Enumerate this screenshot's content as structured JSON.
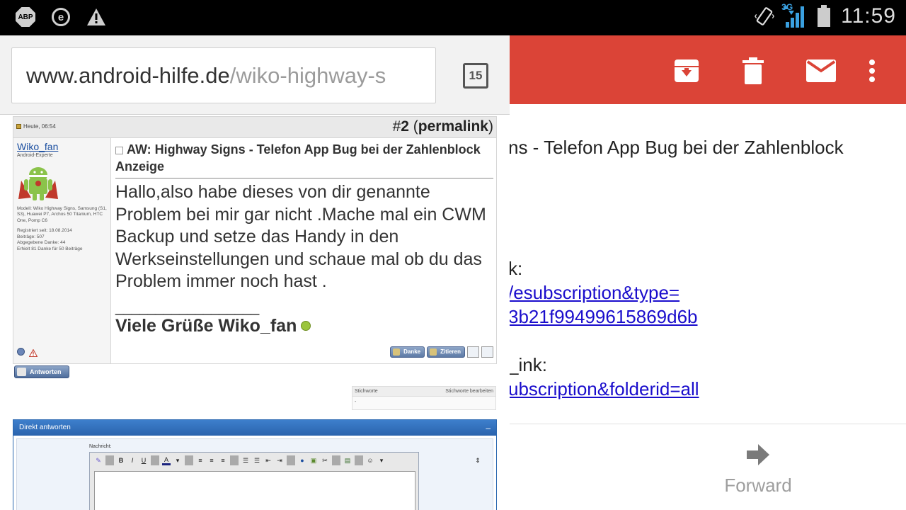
{
  "statusbar": {
    "abp": "ABP",
    "e_icon": "e",
    "network": "3G",
    "time": "11:59",
    "icons": [
      "adblock-plus-icon",
      "e-icon",
      "warning-icon",
      "vibrate-icon",
      "signal-icon",
      "battery-icon"
    ]
  },
  "browser": {
    "url_host": "www.android-hilfe.de",
    "url_path": "/wiko-highway-s",
    "tab_count": "15"
  },
  "post": {
    "date": "Heute, 06:54",
    "number_prefix": "#",
    "number": "2",
    "permalink": "permalink",
    "username": "Wiko_fan",
    "user_rank": "Android-Experte",
    "user_model": "Modell: Wiko Highway Signs, Samsung (S1, S3), Huawei P7, Archos 50 Titanium, HTC One, Pomp C6",
    "registered": "Registriert seit: 18.08.2014",
    "posts": "Beiträge: 507",
    "thanks_given": "Abgegebene Danke: 44",
    "thanks_received": "Erhielt 81 Danke für 50 Beiträge",
    "title": "AW: Highway Signs - Telefon App Bug bei der Zahlenblock Anzeige",
    "body": "Hallo,also habe dieses von dir genannte Problem bei mir gar nicht .Mache mal ein CWM Backup und setze das Handy in den Werkseinstellungen und schaue mal ob du das Problem immer noch hast .",
    "sig_separator": "__________________",
    "signature": "Viele Grüße Wiko_fan",
    "thanks_button": "Danke",
    "quote_button": "Zitieren"
  },
  "reply_button": "Antworten",
  "tags": {
    "label": "Stichworte",
    "edit": "Stichworte bearbeiten",
    "value": "-"
  },
  "quick_reply": {
    "title": "Direkt antworten",
    "toggle": "–",
    "message_label": "Nachricht:",
    "toolbar": [
      "B",
      "I",
      "U",
      "A"
    ]
  },
  "gmail": {
    "colors": {
      "accent": "#db4437"
    },
    "actions": [
      "archive-icon",
      "delete-icon",
      "mail-icon",
      "more-vert-icon"
    ],
    "subject_fragment": "ns - Telefon App Bug bei der Zahlenblock",
    "line1": "k:",
    "link1a": "/esubscription&type=",
    "link1b": "3b21f99499615869d6b",
    "line2": "_ink:",
    "link2": "ubscription&folderid=all",
    "forward": "Forward"
  }
}
